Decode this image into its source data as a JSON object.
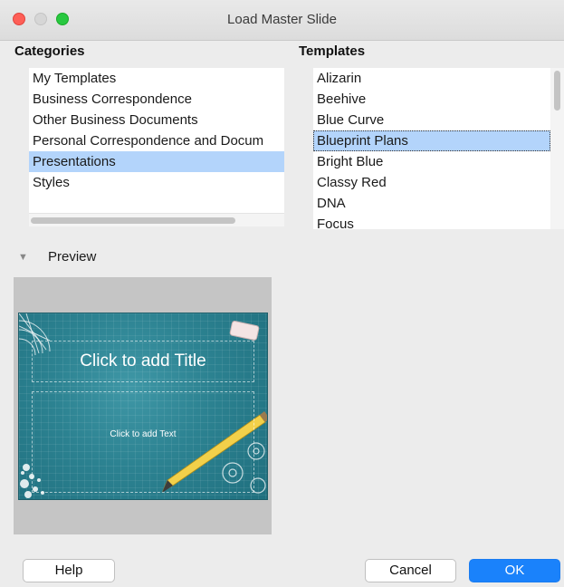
{
  "window": {
    "title": "Load Master Slide"
  },
  "categories": {
    "heading": "Categories",
    "items": [
      "My Templates",
      "Business Correspondence",
      "Other Business Documents",
      "Personal Correspondence and Docum",
      "Presentations",
      "Styles"
    ],
    "selected": "Presentations"
  },
  "templates": {
    "heading": "Templates",
    "items": [
      "Alizarin",
      "Beehive",
      "Blue Curve",
      "Blueprint Plans",
      "Bright Blue",
      "Classy Red",
      "DNA",
      "Focus"
    ],
    "selected": "Blueprint Plans"
  },
  "preview": {
    "toggle_icon": "▼",
    "label": "Preview",
    "slide_title": "Click to add Title",
    "slide_text": "Click to add Text"
  },
  "buttons": {
    "help": "Help",
    "cancel": "Cancel",
    "ok": "OK"
  },
  "colors": {
    "accent": "#1a82fb",
    "selection": "#b3d4fb",
    "slide_bg": "#2c8291"
  }
}
